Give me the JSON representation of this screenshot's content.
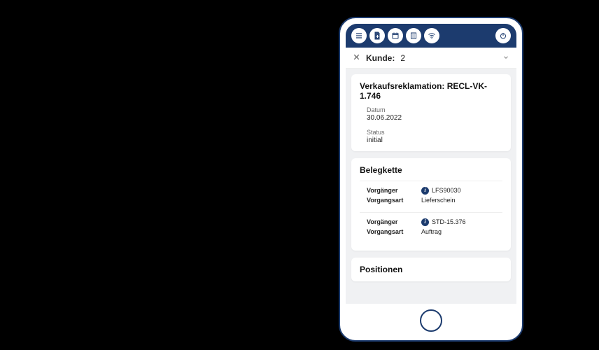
{
  "header": {
    "customer_prefix": "Kunde:",
    "customer_id": "2"
  },
  "detail": {
    "title": "Verkaufsreklamation: RECL-VK-1.746",
    "date_label": "Datum",
    "date_value": "30.06.2022",
    "status_label": "Status",
    "status_value": "initial"
  },
  "chain": {
    "title": "Belegkette",
    "predecessor_label": "Vorgänger",
    "type_label": "Vorgangsart",
    "rows": [
      {
        "code": "LFS90030",
        "type": "Lieferschein"
      },
      {
        "code": "STD-15.376",
        "type": "Auftrag"
      }
    ]
  },
  "positions": {
    "title": "Positionen"
  }
}
